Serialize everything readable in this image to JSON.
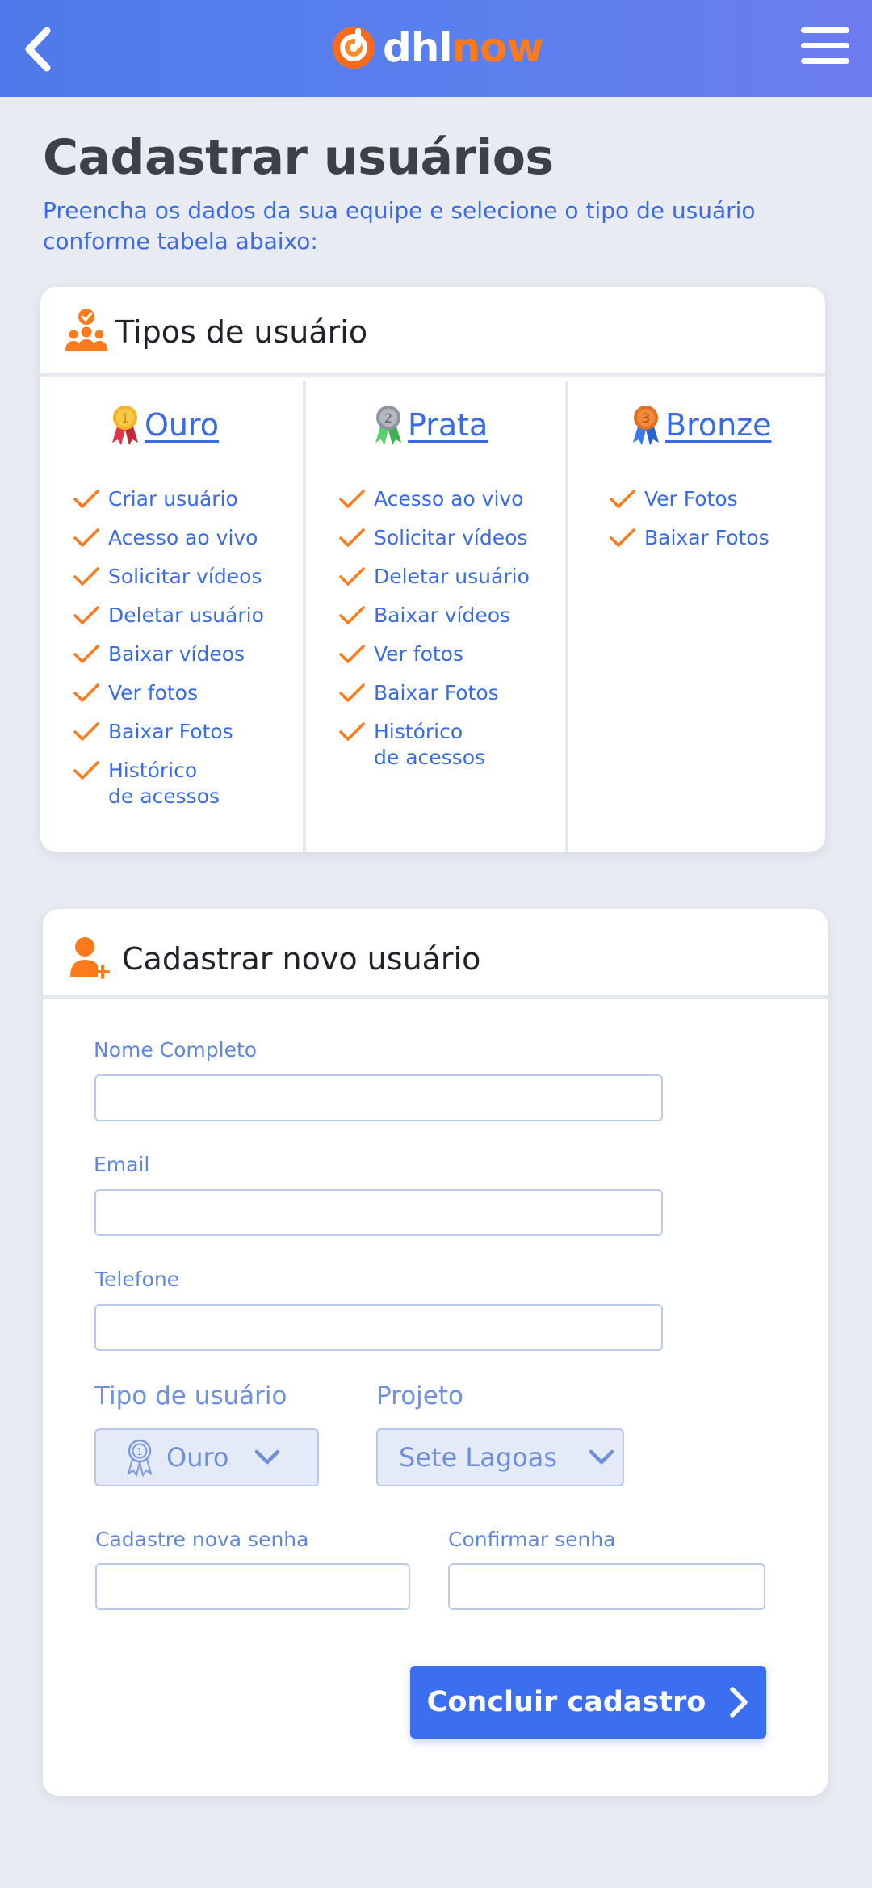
{
  "header": {
    "logo_part1": "dhl",
    "logo_part2": "now"
  },
  "page": {
    "title": "Cadastrar usuários",
    "subtitle": "Preencha os dados da sua equipe e selecione o tipo de usuário conforme tabela abaixo:"
  },
  "user_types": {
    "title": "Tipos de usuário",
    "tiers": [
      {
        "label": "Ouro",
        "medal_number": "1",
        "permissions": [
          "Criar usuário",
          "Acesso ao vivo",
          "Solicitar vídeos",
          "Deletar usuário",
          "Baixar vídeos",
          "Ver fotos",
          "Baixar Fotos",
          "Histórico\nde acessos"
        ]
      },
      {
        "label": "Prata",
        "medal_number": "2",
        "permissions": [
          "Acesso ao vivo",
          "Solicitar vídeos",
          "Deletar usuário",
          "Baixar vídeos",
          "Ver fotos",
          "Baixar Fotos",
          "Histórico\nde acessos"
        ]
      },
      {
        "label": "Bronze",
        "medal_number": "3",
        "permissions": [
          "Ver Fotos",
          "Baixar Fotos"
        ]
      }
    ]
  },
  "form": {
    "title": "Cadastrar novo usuário",
    "name_label": "Nome Completo",
    "name_value": "",
    "email_label": "Email",
    "email_value": "",
    "phone_label": "Telefone",
    "phone_value": "",
    "user_type_label": "Tipo de usuário",
    "user_type_value": "Ouro",
    "project_label": "Projeto",
    "project_value": "Sete Lagoas",
    "password_label": "Cadastre nova senha",
    "password_value": "",
    "confirm_label": "Confirmar senha",
    "confirm_value": "",
    "submit_label": "Concluir cadastro"
  },
  "icons": {
    "back": "chevron-left-icon",
    "menu": "hamburger-menu-icon",
    "logo": "dhlnow-logo-icon",
    "user_types": "users-group-icon",
    "add_user": "user-plus-icon",
    "check": "check-icon",
    "chevron_down": "chevron-down-icon",
    "chevron_right": "chevron-right-icon"
  },
  "colors": {
    "header_start": "#4f79ea",
    "header_end": "#6d7cf0",
    "accent_blue": "#3b6ff0",
    "accent_orange": "#ff7a1a",
    "gold": "#f2b52a",
    "silver": "#9aa0a8",
    "bronze": "#e8822d"
  }
}
